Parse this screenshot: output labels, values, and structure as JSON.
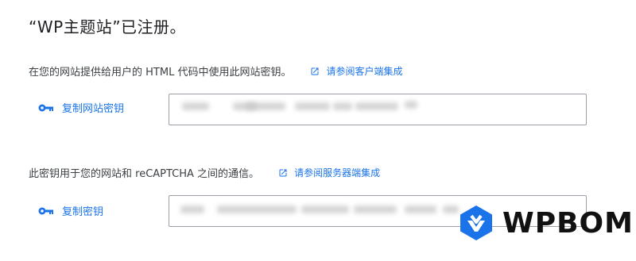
{
  "page_title": "“WP主题站”已注册。",
  "site_key": {
    "description": "在您的网站提供给用户的 HTML 代码中使用此网站密钥。",
    "link_label": "请参阅客户端集成",
    "copy_label": "复制网站密钥",
    "value": ""
  },
  "secret_key": {
    "description": "此密钥用于您的网站和 reCAPTCHA 之间的通信。",
    "link_label": "请参阅服务器端集成",
    "copy_label": "复制密钥",
    "value": ""
  },
  "watermark": {
    "text": "WPBOM"
  },
  "colors": {
    "accent": "#1a73e8",
    "text": "#202124",
    "border": "#9aa0a6"
  }
}
